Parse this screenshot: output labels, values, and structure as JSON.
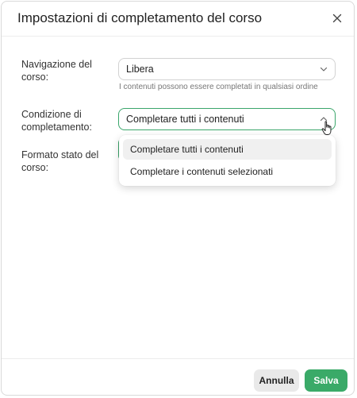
{
  "dialog": {
    "title": "Impostazioni di completamento del corso",
    "close_icon": "close-icon"
  },
  "fields": {
    "navigation": {
      "label": "Navigazione del corso:",
      "value": "Libera",
      "hint": "I contenuti possono essere completati in qualsiasi ordine"
    },
    "completion": {
      "label": "Condizione di completamento:",
      "value": "Completare tutti i contenuti",
      "options": [
        "Completare tutti i contenuti",
        "Completare i contenuti selezionati"
      ],
      "selected_index": 0
    },
    "status_format": {
      "label": "Formato stato del corso:"
    }
  },
  "footer": {
    "cancel_label": "Annulla",
    "save_label": "Salva"
  },
  "colors": {
    "accent": "#3aaa68",
    "border": "#d2d2d2"
  }
}
